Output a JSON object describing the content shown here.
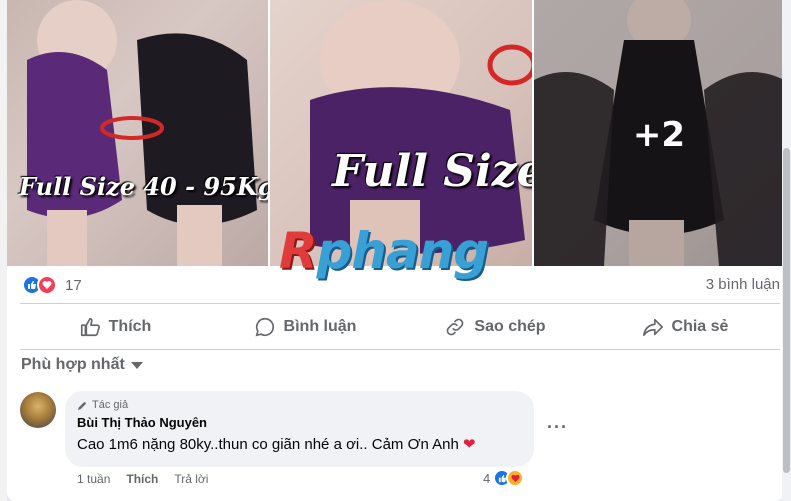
{
  "photos": {
    "photo1_caption": "Full Size 40 - 95Kg",
    "photo2_caption": "Full Size",
    "more_count": "+2",
    "watermark_first": "R",
    "watermark_rest": "phang"
  },
  "reactions": {
    "count": "17",
    "comments": "3 bình luận"
  },
  "actions": {
    "like": "Thích",
    "comment": "Bình luận",
    "copy": "Sao chép",
    "share": "Chia sẻ"
  },
  "comments_section": {
    "sort_label": "Phù hợp nhất",
    "first_comment": {
      "badge": "Tác giả",
      "author": "Bùi Thị Thảo Nguyên",
      "text": "Cao 1m6 nặng 80ky..thun co giãn nhé a ơi.. Cảm Ơn Anh",
      "time": "1 tuần",
      "like": "Thích",
      "reply": "Trả lời",
      "reaction_count": "4"
    }
  },
  "colors": {
    "accent": "#1b74e4",
    "love": "#f33e58",
    "muted": "#65676b"
  }
}
